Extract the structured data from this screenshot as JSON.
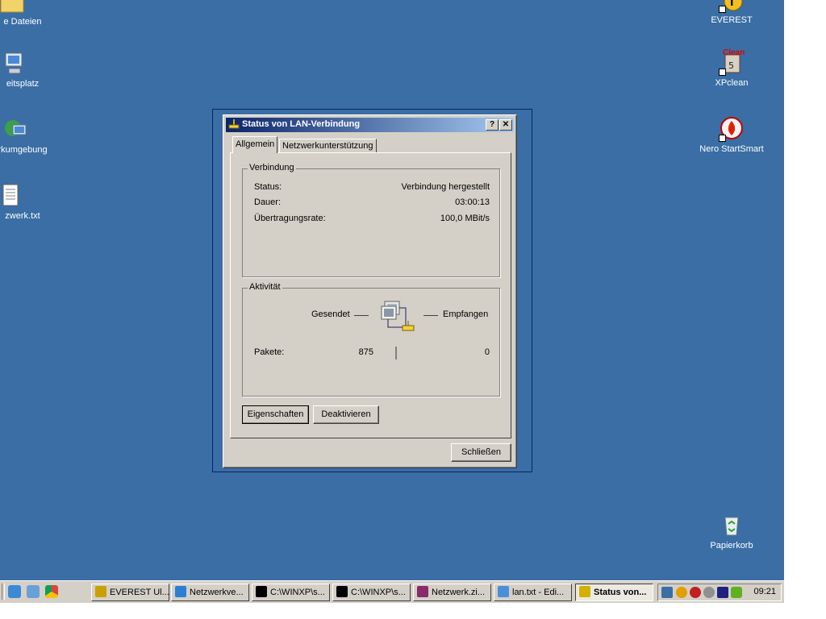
{
  "desktop": {
    "left_icons": [
      {
        "label": "e Dateien",
        "icon": "folder-icon"
      },
      {
        "label": "eitsplatz",
        "icon": "computer-icon"
      },
      {
        "label": "rkumgebung",
        "icon": "network-icon"
      },
      {
        "label": "zwerk.txt",
        "icon": "text-file-icon"
      }
    ],
    "right_icons": [
      {
        "label": "EVEREST",
        "icon": "everest-icon"
      },
      {
        "label": "XPclean",
        "icon": "xpclean-icon",
        "badge": "Clean"
      },
      {
        "label": "Nero StartSmart",
        "icon": "nero-icon"
      },
      {
        "label": "Papierkorb",
        "icon": "recycle-bin-icon"
      }
    ]
  },
  "dialog": {
    "title": "Status von LAN-Verbindung",
    "help_button": "?",
    "close_button": "✕",
    "tabs": [
      "Allgemein",
      "Netzwerkunterstützung"
    ],
    "connection": {
      "group_title": "Verbindung",
      "rows": [
        {
          "label": "Status:",
          "value": "Verbindung hergestellt"
        },
        {
          "label": "Dauer:",
          "value": "03:00:13"
        },
        {
          "label": "Übertragungsrate:",
          "value": "100,0 MBit/s"
        }
      ]
    },
    "activity": {
      "group_title": "Aktivität",
      "sent_label": "Gesendet",
      "received_label": "Empfangen",
      "packets_label": "Pakete:",
      "packets_sent": "875",
      "packets_received": "0"
    },
    "buttons": {
      "properties": "Eigenschaften",
      "disable": "Deaktivieren",
      "close": "Schließen"
    }
  },
  "taskbar": {
    "tasks": [
      {
        "label": "EVEREST Ul...",
        "icon": "everest-icon",
        "color": "#c8a000"
      },
      {
        "label": "Netzwerkve...",
        "icon": "network-icon",
        "color": "#2a7fd4"
      },
      {
        "label": "C:\\WINXP\\s...",
        "icon": "console-icon",
        "color": "#000000"
      },
      {
        "label": "C:\\WINXP\\s...",
        "icon": "console-icon",
        "color": "#000000"
      },
      {
        "label": "Netzwerk.zi...",
        "icon": "winrar-icon",
        "color": "#8a2a6a"
      },
      {
        "label": "lan.txt - Edi...",
        "icon": "editor-icon",
        "color": "#4a90d9"
      },
      {
        "label": "Status von...",
        "icon": "lan-status-icon",
        "color": "#d4b000",
        "active": true
      }
    ],
    "clock": "09:21"
  },
  "colors": {
    "desktop": "#3a6ea5",
    "title_start": "#0a246a",
    "title_end": "#a6caf0",
    "face": "#d4d0c8"
  }
}
